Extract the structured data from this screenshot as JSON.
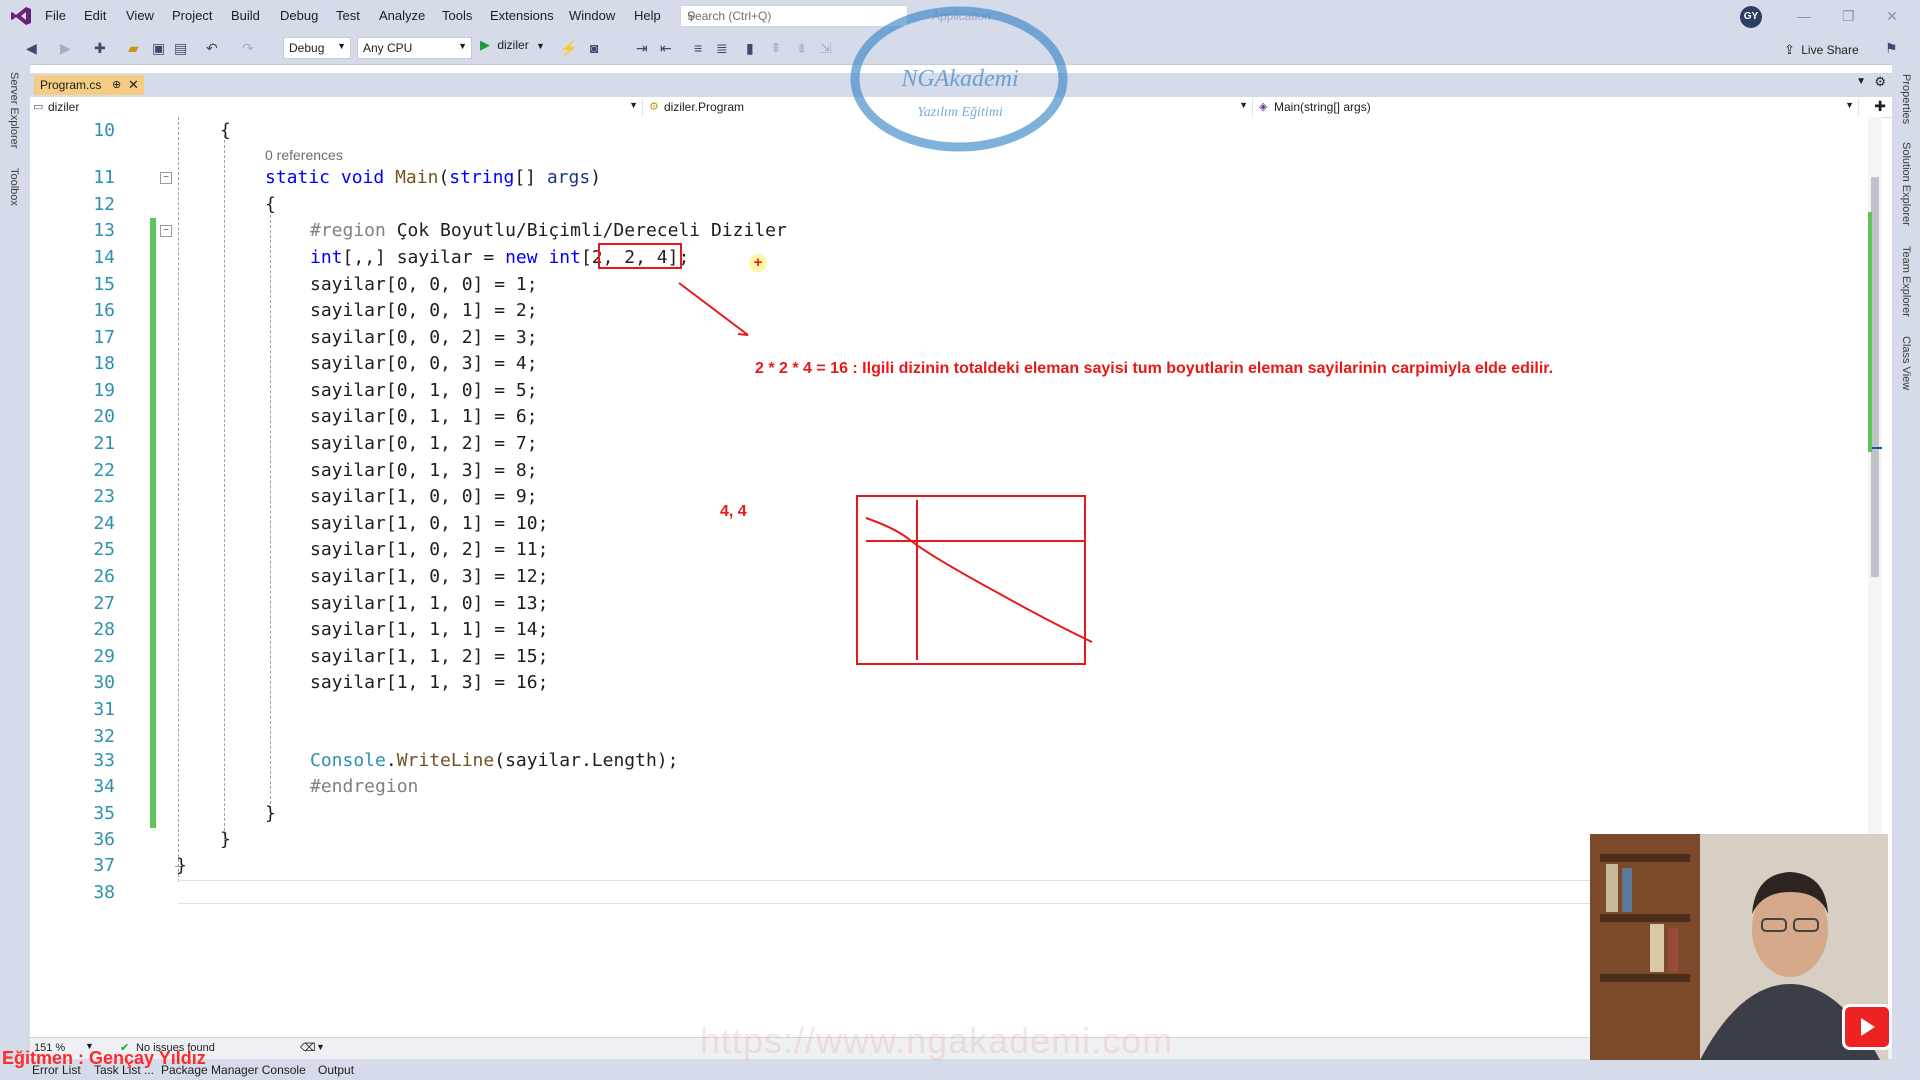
{
  "menubar": {
    "items": [
      "File",
      "Edit",
      "View",
      "Project",
      "Build",
      "Debug",
      "Test",
      "Analyze",
      "Tools",
      "Extensions",
      "Window",
      "Help"
    ],
    "search_placeholder": "Search (Ctrl+Q)",
    "app_label": "Application",
    "user_initials": "GY"
  },
  "toolbar": {
    "configuration": "Debug",
    "platform": "Any CPU",
    "run_target": "diziler",
    "live_share": "Live Share"
  },
  "left_rail": {
    "items": [
      "Server Explorer",
      "Toolbox"
    ]
  },
  "right_rail": {
    "items": [
      "Properties",
      "Solution Explorer",
      "Team Explorer",
      "Class View"
    ]
  },
  "tab": {
    "label": "Program.cs",
    "pin": "⊕",
    "close": "✕"
  },
  "navbar": {
    "project": "diziler",
    "class": "diziler.Program",
    "member": "Main(string[] args)"
  },
  "editor": {
    "references": "0 references",
    "lines": [
      {
        "n": "10"
      },
      {
        "n": "11"
      },
      {
        "n": "12"
      },
      {
        "n": "13"
      },
      {
        "n": "14"
      },
      {
        "n": "15"
      },
      {
        "n": "16"
      },
      {
        "n": "17"
      },
      {
        "n": "18"
      },
      {
        "n": "19"
      },
      {
        "n": "20"
      },
      {
        "n": "21"
      },
      {
        "n": "22"
      },
      {
        "n": "23"
      },
      {
        "n": "24"
      },
      {
        "n": "25"
      },
      {
        "n": "26"
      },
      {
        "n": "27"
      },
      {
        "n": "28"
      },
      {
        "n": "29"
      },
      {
        "n": "30"
      },
      {
        "n": "31"
      },
      {
        "n": "32"
      },
      {
        "n": "33"
      },
      {
        "n": "34"
      },
      {
        "n": "35"
      },
      {
        "n": "36"
      },
      {
        "n": "37"
      },
      {
        "n": "38"
      }
    ],
    "code": {
      "l10": "{",
      "l11_kw1": "static",
      "l11_kw2": "void",
      "l11_m": "Main",
      "l11_a": "(",
      "l11_kw3": "string",
      "l11_b": "[] ",
      "l11_p": "args",
      "l11_c": ")",
      "l12": "{",
      "l13_region": "#region",
      "l13_text": " Çok Boyutlu/Biçimli/Dereceli Diziler",
      "l14_a": "int",
      "l14_b": "[,,] sayilar = ",
      "l14_c": "new",
      "l14_d": " ",
      "l14_e": "int",
      "l14_f": "[2, 2, 4];",
      "assign": [
        "sayilar[0, 0, 0] = 1;",
        "sayilar[0, 0, 1] = 2;",
        "sayilar[0, 0, 2] = 3;",
        "sayilar[0, 0, 3] = 4;",
        "sayilar[0, 1, 0] = 5;",
        "sayilar[0, 1, 1] = 6;",
        "sayilar[0, 1, 2] = 7;",
        "sayilar[0, 1, 3] = 8;",
        "sayilar[1, 0, 0] = 9;",
        "sayilar[1, 0, 1] = 10;",
        "sayilar[1, 0, 2] = 11;",
        "sayilar[1, 0, 3] = 12;",
        "sayilar[1, 1, 0] = 13;",
        "sayilar[1, 1, 1] = 14;",
        "sayilar[1, 1, 2] = 15;",
        "sayilar[1, 1, 3] = 16;"
      ],
      "l33_a": "Console",
      "l33_b": ".",
      "l33_c": "WriteLine",
      "l33_d": "(sayilar.Length);",
      "l34": "#endregion",
      "l35": "}",
      "l36": "}",
      "l37": "}"
    }
  },
  "annotations": {
    "note": "2 * 2 * 4 = 16 : Ilgili dizinin totaldeki eleman sayisi tum boyutlarin eleman sayilarinin carpimiyla elde edilir.",
    "coord": "4, 4",
    "cursor": "+"
  },
  "watermark": {
    "logo_line1": "NGAkademi",
    "logo_line2": "Yazılım Eğitimi",
    "url": "https://www.ngakademi.com"
  },
  "statusbar": {
    "zoom": "151 %",
    "issues": "No issues found"
  },
  "bottom_tabs": [
    "Error List",
    "Task List ...",
    "Package Manager Console",
    "Output"
  ],
  "presenter": "Eğitmen : Gençay Yıldız",
  "colors": {
    "accent": "#e81818",
    "tab_active": "#f5cc84",
    "chrome": "#d6dbe9"
  }
}
